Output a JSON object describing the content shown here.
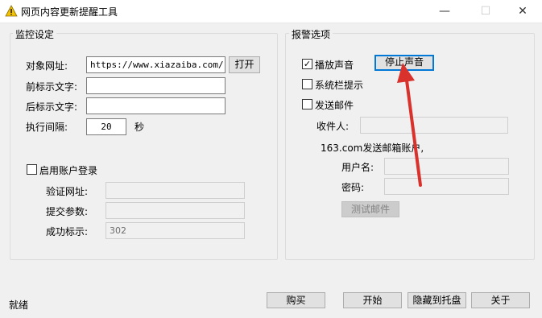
{
  "window": {
    "title": "网页内容更新提醒工具",
    "minimize_glyph": "—",
    "maximize_glyph": "☐",
    "close_glyph": "✕"
  },
  "monitor": {
    "group_title": "监控设定",
    "url_label": "对象网址:",
    "url_value": "https://www.xiazaiba.com/",
    "open_button": "打开",
    "prefix_label": "前标示文字:",
    "prefix_value": "",
    "suffix_label": "后标示文字:",
    "suffix_value": "",
    "interval_label": "执行间隔:",
    "interval_value": "20",
    "interval_unit": "秒",
    "login_checkbox_label": "启用账户登录",
    "login_checked": false,
    "verify_url_label": "验证网址:",
    "verify_url_value": "",
    "submit_params_label": "提交参数:",
    "submit_params_value": "",
    "success_label": "成功标示:",
    "success_value": "302"
  },
  "alert": {
    "group_title": "报警选项",
    "play_sound_label": "播放声音",
    "play_sound_checked": true,
    "stop_sound_button": "停止声音",
    "tray_tip_label": "系统栏提示",
    "tray_tip_checked": false,
    "send_mail_label": "发送邮件",
    "send_mail_checked": false,
    "recipient_label": "收件人:",
    "recipient_value": "",
    "mail_account_caption": "163.com发送邮箱账户,",
    "username_label": "用户名:",
    "username_value": "",
    "password_label": "密码:",
    "password_value": "",
    "test_mail_button": "测试邮件"
  },
  "footer": {
    "status_text": "就绪",
    "buy_button": "购买",
    "start_button": "开始",
    "hide_tray_button": "隐藏到托盘",
    "about_button": "关于"
  },
  "check_glyph": "✓",
  "colors": {
    "annotation_arrow": "#d9322d",
    "focus_border": "#0078d7",
    "window_bg": "#f0f0f0"
  }
}
